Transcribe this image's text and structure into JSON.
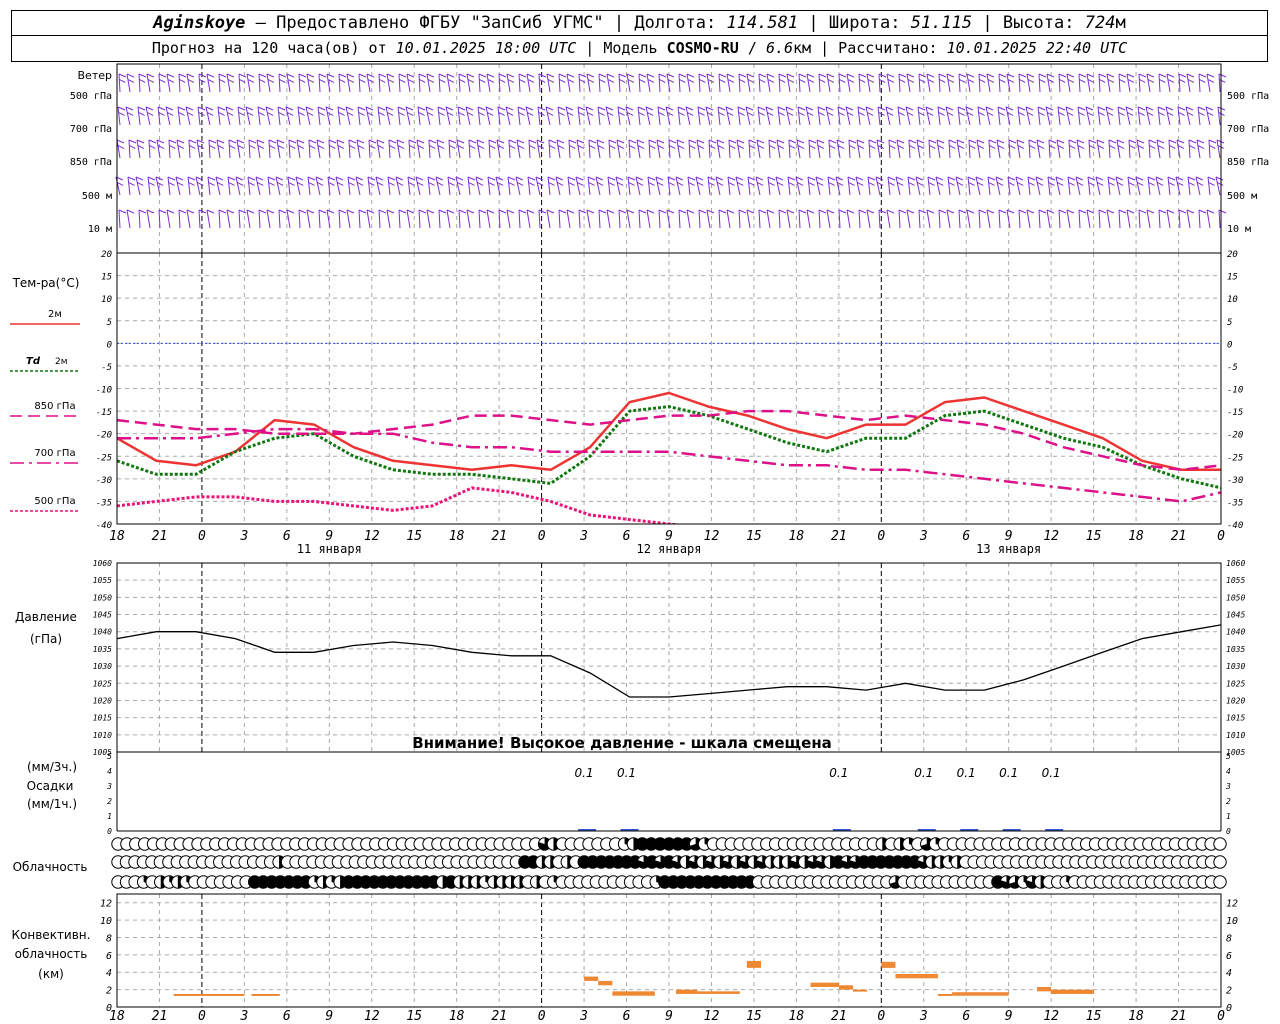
{
  "header": {
    "station": "Aginskoye",
    "provider": " – Предоставлено ФГБУ \"ЗапСиб УГМС\" | Долгота: ",
    "lon": "114.581",
    "lat_label": " | Широта: ",
    "lat": "51.115",
    "alt_label": " | Высота: ",
    "alt": "724",
    "alt_unit": "м",
    "forecast_prefix": "Прогноз на 120 часа(ов) от ",
    "forecast_time": "10.01.2025 18:00 UTC",
    "model_label": "  | Модель ",
    "model": "COSMO-RU",
    "res_sep": " / ",
    "res": "6.6",
    "res_unit": "км",
    "calc_label": " | Рассчитано: ",
    "calc_time": "10.01.2025 22:40 UTC"
  },
  "chart_data": [
    {
      "type": "barbs",
      "panel": "wind",
      "title": "Ветер",
      "levels": [
        "500 гПа",
        "700 гПа",
        "850 гПа",
        "500 м",
        "10  м"
      ],
      "color": "#7b2fd6"
    },
    {
      "type": "line",
      "panel": "temperature",
      "ylabel": "Тем-ра(°C)",
      "ylim": [
        -40,
        20
      ],
      "yticks": [
        20,
        15,
        10,
        5,
        0,
        -5,
        -10,
        -15,
        -20,
        -25,
        -30,
        -35,
        -40
      ],
      "x_ticks": [
        "18",
        "21",
        "0",
        "3",
        "6",
        "9",
        "12",
        "15",
        "18",
        "21",
        "0",
        "3",
        "6",
        "9",
        "12",
        "15",
        "18",
        "21",
        "0",
        "3",
        "6",
        "9",
        "12",
        "15",
        "18",
        "21",
        "0"
      ],
      "days": [
        "11 января",
        "12 января",
        "13 января"
      ],
      "x_hours": [
        0,
        3,
        6,
        9,
        12,
        15,
        18,
        21,
        24,
        27,
        30,
        33,
        36,
        39,
        42,
        45,
        48,
        51,
        54,
        57,
        60,
        63,
        66,
        69,
        72,
        75,
        78
      ],
      "series": [
        {
          "name": "2м",
          "color": "#ee3333",
          "style": "solid",
          "values": [
            -21,
            -26,
            -27,
            -24,
            -17,
            -18,
            -23,
            -26,
            -27,
            -28,
            -27,
            -28,
            -23,
            -13,
            -11,
            -14,
            -16,
            -19,
            -21,
            -18,
            -18,
            -13,
            -12,
            -15,
            -18,
            -21,
            -26,
            -28,
            -28
          ]
        },
        {
          "name": "Td 2м",
          "color": "#117711",
          "style": "dotted",
          "values": [
            -26,
            -29,
            -29,
            -24,
            -21,
            -20,
            -25,
            -28,
            -29,
            -29,
            -30,
            -31,
            -25,
            -15,
            -14,
            -16,
            -19,
            -22,
            -24,
            -21,
            -21,
            -16,
            -15,
            -18,
            -21,
            -23,
            -27,
            -30,
            -32
          ]
        },
        {
          "name": "850 гПа",
          "color": "#dd1188",
          "style": "dashed",
          "values": [
            -17,
            -18,
            -19,
            -19,
            -20,
            -20,
            -20,
            -19,
            -18,
            -16,
            -16,
            -17,
            -18,
            -17,
            -16,
            -16,
            -15,
            -15,
            -16,
            -17,
            -16,
            -17,
            -18,
            -20,
            -23,
            -25,
            -27,
            -28,
            -27
          ]
        },
        {
          "name": "700 гПа",
          "color": "#dd1188",
          "style": "dashdot",
          "values": [
            -21,
            -21,
            -21,
            -20,
            -19,
            -19,
            -20,
            -20,
            -22,
            -23,
            -23,
            -24,
            -24,
            -24,
            -24,
            -25,
            -26,
            -27,
            -27,
            -28,
            -28,
            -29,
            -30,
            -31,
            -32,
            -33,
            -34,
            -35,
            -33
          ]
        },
        {
          "name": "500 гПа",
          "color": "#ee1177",
          "style": "dotted",
          "values": [
            -36,
            -35,
            -34,
            -34,
            -35,
            -35,
            -36,
            -37,
            -36,
            -32,
            -33,
            -35,
            -38,
            -39,
            -40,
            -41,
            null,
            null,
            null,
            null,
            null,
            null,
            null,
            null,
            null,
            null,
            null,
            null,
            -37
          ]
        }
      ]
    },
    {
      "type": "line",
      "panel": "pressure",
      "ylabel": "Давление",
      "yunit": "(гПа)",
      "ylim": [
        1005,
        1060
      ],
      "yticks": [
        1060,
        1055,
        1050,
        1045,
        1040,
        1035,
        1030,
        1025,
        1020,
        1015,
        1010,
        1005
      ],
      "warning": "Внимание! Высокое давление - шкала смещена",
      "series": [
        {
          "name": "Давление",
          "color": "#000000",
          "values": [
            1038,
            1040,
            1040,
            1038,
            1034,
            1034,
            1036,
            1037,
            1036,
            1034,
            1033,
            1033,
            1028,
            1021,
            1021,
            1022,
            1023,
            1024,
            1024,
            1023,
            1025,
            1023,
            1023,
            1026,
            1030,
            1034,
            1038,
            1040,
            1042
          ]
        }
      ]
    },
    {
      "type": "bar",
      "panel": "precipitation",
      "ylabel_top": "(мм/3ч.)",
      "ylabel_mid": "Осадки",
      "ylabel_bot": "(мм/1ч.)",
      "ylim": [
        0,
        5
      ],
      "yticks": [
        5,
        4,
        3,
        2,
        1,
        0
      ],
      "labels": [
        {
          "hour": 33,
          "text": "0.1"
        },
        {
          "hour": 36,
          "text": "0.1"
        },
        {
          "hour": 51,
          "text": "0.1"
        },
        {
          "hour": 57,
          "text": "0.1"
        },
        {
          "hour": 60,
          "text": "0.1"
        },
        {
          "hour": 63,
          "text": "0.1"
        },
        {
          "hour": 66,
          "text": "0.1"
        }
      ]
    },
    {
      "type": "table",
      "panel": "cloud",
      "label": "Облачность",
      "note": "cloud cover fraction per hour, 3 levels (high, mid, low), 0..1",
      "rows": [
        [
          0,
          0,
          0,
          0,
          0,
          0,
          0,
          0,
          0,
          0,
          0,
          0,
          0,
          0,
          0,
          0,
          0,
          0,
          0,
          0,
          0,
          0,
          0,
          0,
          0,
          0,
          0,
          0,
          0,
          0,
          0,
          0,
          0,
          0,
          0,
          0,
          0,
          0,
          0,
          0,
          0,
          0,
          0,
          0,
          0,
          0,
          0,
          0,
          0.8,
          0.5,
          0,
          0,
          0,
          0,
          0,
          0,
          0,
          0.3,
          0.5,
          1,
          1,
          1,
          1,
          1,
          1,
          0.7,
          0.3,
          0,
          0,
          0,
          0,
          0,
          0,
          0,
          0,
          0,
          0,
          0,
          0,
          0,
          0,
          0,
          0,
          0,
          0,
          0,
          0.5,
          0,
          0.5,
          0.3,
          0,
          0.7,
          0.3,
          0,
          0,
          0,
          0,
          0,
          0,
          0,
          0,
          0,
          0,
          0,
          0,
          0,
          0,
          0,
          0,
          0,
          0,
          0,
          0,
          0,
          0,
          0,
          0,
          0,
          0,
          0,
          0,
          0,
          0,
          0,
          0
        ],
        [
          0,
          0,
          0,
          0,
          0,
          0,
          0,
          0,
          0,
          0,
          0,
          0,
          0,
          0,
          0,
          0,
          0,
          0,
          0,
          0.5,
          0,
          0,
          0,
          0,
          0,
          0,
          0,
          0,
          0,
          0,
          0,
          0,
          0,
          0,
          0,
          0,
          0,
          0,
          0,
          0,
          0,
          0,
          0,
          0,
          0,
          0,
          0,
          0,
          1,
          1,
          0.5,
          0.5,
          0,
          0.5,
          0,
          1,
          1,
          1,
          1,
          1,
          1,
          1,
          0.8,
          1,
          0.8,
          1,
          0.8,
          0.5,
          0.8,
          0.5,
          0.8,
          0.5,
          0.8,
          0.5,
          0.8,
          0.5,
          0.8,
          0.5,
          0.5,
          0.5,
          0.8,
          0.5,
          0.8,
          0.8,
          0.5,
          1,
          0.8,
          0.8,
          1,
          1,
          1,
          1,
          1,
          1,
          1,
          0.8,
          0.5,
          0.5,
          0.3,
          0.5,
          0,
          0,
          0,
          0,
          0,
          0,
          0,
          0,
          0,
          0,
          0,
          0,
          0,
          0,
          0,
          0,
          0,
          0,
          0,
          0,
          0,
          0,
          0,
          0,
          0,
          0,
          0,
          0,
          0,
          0,
          0
        ],
        [
          0,
          0,
          0,
          0.3,
          0,
          0.5,
          0.3,
          0.5,
          0.3,
          0,
          0,
          0,
          0,
          0,
          0,
          0,
          1,
          1,
          1,
          1,
          1,
          1,
          1,
          0.3,
          0.5,
          0.3,
          0.5,
          1,
          1,
          1,
          1,
          1,
          1,
          1,
          1,
          1,
          1,
          1,
          0.5,
          1,
          0.5,
          0.5,
          0.5,
          0.3,
          0.5,
          0.5,
          0.5,
          0.5,
          0,
          0.5,
          0,
          0.3,
          0,
          0,
          0,
          0,
          0,
          0,
          0,
          0,
          0,
          0,
          0,
          0.3,
          1,
          1,
          1,
          1,
          1,
          1,
          1,
          1,
          1,
          1,
          1,
          0,
          0,
          0,
          0,
          0,
          0,
          0,
          0,
          0,
          0,
          0,
          0,
          0,
          0,
          0,
          0,
          0.7,
          0,
          0,
          0,
          0,
          0,
          0,
          0,
          0,
          0,
          0,
          0,
          1,
          0.8,
          0.7,
          0.3,
          0.8,
          0.5,
          0,
          0,
          0.3,
          0,
          0,
          0,
          0,
          0,
          0,
          0,
          0,
          0,
          0,
          0,
          0,
          0,
          0,
          0,
          0,
          0,
          0
        ]
      ]
    },
    {
      "type": "bar",
      "panel": "convective",
      "ylabel_top": "Конвективн.",
      "ylabel_mid": "облачность",
      "ylabel_bot": "(км)",
      "ylim": [
        0,
        13
      ],
      "yticks": [
        12,
        10,
        8,
        6,
        4,
        2,
        0
      ],
      "color": "#ee8833",
      "segments": [
        {
          "h0": 4,
          "h1": 9,
          "base": 1.3,
          "top": 1.5
        },
        {
          "h0": 9.5,
          "h1": 11.5,
          "base": 1.3,
          "top": 1.5
        },
        {
          "h0": 33,
          "h1": 34,
          "base": 3,
          "top": 3.5
        },
        {
          "h0": 34,
          "h1": 35,
          "base": 2.5,
          "top": 3
        },
        {
          "h0": 35,
          "h1": 38,
          "base": 1.3,
          "top": 1.8
        },
        {
          "h0": 39.5,
          "h1": 41,
          "base": 1.5,
          "top": 2
        },
        {
          "h0": 41,
          "h1": 44,
          "base": 1.5,
          "top": 1.8
        },
        {
          "h0": 44.5,
          "h1": 45.5,
          "base": 4.5,
          "top": 5.3
        },
        {
          "h0": 49,
          "h1": 51,
          "base": 2.3,
          "top": 2.8
        },
        {
          "h0": 51,
          "h1": 52,
          "base": 2,
          "top": 2.5
        },
        {
          "h0": 52,
          "h1": 53,
          "base": 1.8,
          "top": 2
        },
        {
          "h0": 54,
          "h1": 55,
          "base": 4.5,
          "top": 5.2
        },
        {
          "h0": 55,
          "h1": 58,
          "base": 3.3,
          "top": 3.8
        },
        {
          "h0": 58,
          "h1": 59,
          "base": 1.3,
          "top": 1.5
        },
        {
          "h0": 59,
          "h1": 63,
          "base": 1.3,
          "top": 1.7
        },
        {
          "h0": 65,
          "h1": 66,
          "base": 1.8,
          "top": 2.3
        },
        {
          "h0": 66,
          "h1": 69,
          "base": 1.5,
          "top": 2
        }
      ]
    }
  ]
}
